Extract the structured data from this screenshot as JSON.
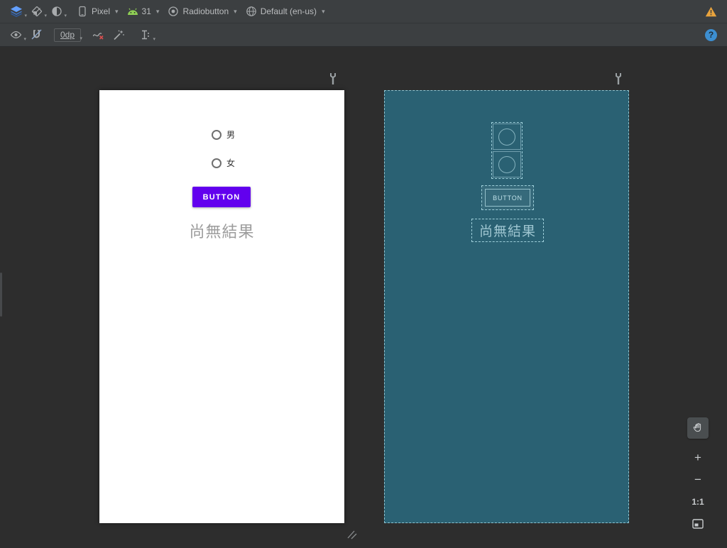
{
  "toolbar": {
    "device": {
      "label": "Pixel"
    },
    "api": {
      "label": "31"
    },
    "theme": {
      "label": "Radiobutton"
    },
    "locale": {
      "label": "Default (en-us)"
    }
  },
  "constraint_toolbar": {
    "default_margin": "0dp",
    "help": "?"
  },
  "design": {
    "radios": [
      {
        "label": "男"
      },
      {
        "label": "女"
      }
    ],
    "button_label": "BUTTON",
    "result_text": "尚無結果"
  },
  "blueprint": {
    "button_label": "BUTTON",
    "result_text": "尚無結果"
  },
  "zoom": {
    "zoom_in": "+",
    "zoom_out": "−",
    "ratio_label": "1:1"
  },
  "colors": {
    "accent_purple": "#6200ee",
    "blueprint_bg": "#2a6173",
    "blueprint_line": "#9ecfda",
    "warning": "#e8a33d",
    "android_green": "#8fce55"
  }
}
